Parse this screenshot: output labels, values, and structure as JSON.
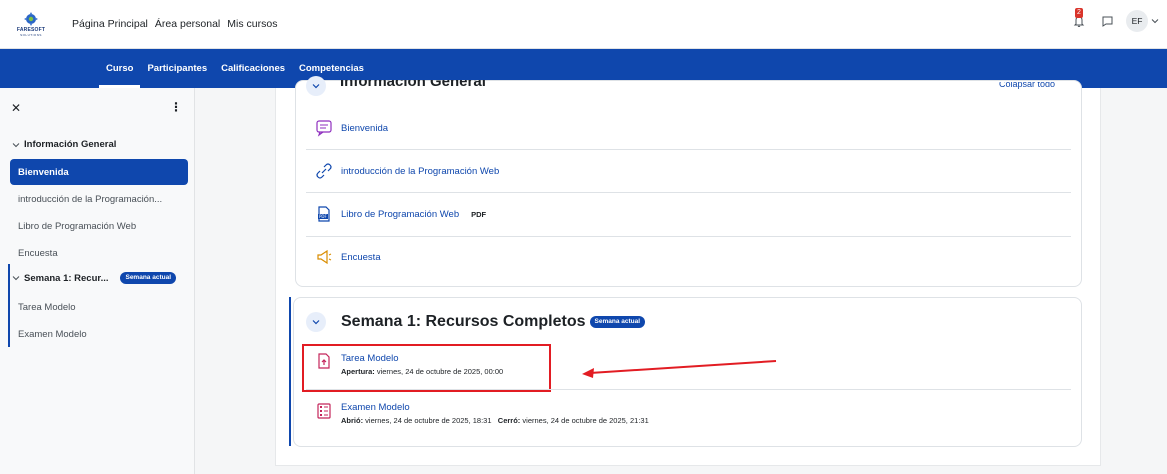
{
  "topbar": {
    "logo_text": "FARESOFT",
    "logo_subtext": "SOLUTIONS",
    "nav": [
      "Página Principal",
      "Área personal",
      "Mis cursos"
    ],
    "notification_count": "2",
    "user_initials": "EF"
  },
  "secondary_nav": {
    "tabs": [
      "Curso",
      "Participantes",
      "Calificaciones",
      "Competencias"
    ],
    "active": "Curso"
  },
  "drawer": {
    "section1": "Información General",
    "items1": [
      "Bienvenida",
      "introducción de la Programación...",
      "Libro de Programación Web",
      "Encuesta"
    ],
    "section2": "Semana 1: Recur...",
    "section2_badge": "Semana actual",
    "items2": [
      "Tarea Modelo",
      "Examen Modelo"
    ]
  },
  "content": {
    "section1_title": "Información General",
    "collapse_all": "Colapsar todo",
    "section1_activities": [
      {
        "label": "Bienvenida",
        "icon": "forum-icon"
      },
      {
        "label": "introducción de la Programación Web",
        "icon": "link-icon"
      },
      {
        "label": "Libro de Programación Web",
        "tag": "PDF",
        "icon": "pdf-icon"
      },
      {
        "label": "Encuesta",
        "icon": "megaphone-icon"
      }
    ],
    "section2_title": "Semana 1: Recursos Completos",
    "section2_badge": "Semana actual",
    "section2_activities": [
      {
        "label": "Tarea Modelo",
        "meta1_label": "Apertura:",
        "meta1_value": " viernes, 24 de octubre de 2025, 00:00",
        "icon": "assignment-upload-icon"
      },
      {
        "label": "Examen Modelo",
        "meta1_label": "Abrió:",
        "meta1_value": " viernes, 24 de octubre de 2025, 18:31",
        "meta2_label": "Cerró:",
        "meta2_value": " viernes, 24 de octubre de 2025, 21:31",
        "icon": "quiz-icon"
      }
    ]
  },
  "colors": {
    "brand_blue": "#0f47ad",
    "annotation_red": "#e21c23",
    "assignment_pink": "#c4255b",
    "link_blue": "#0f47ad"
  }
}
